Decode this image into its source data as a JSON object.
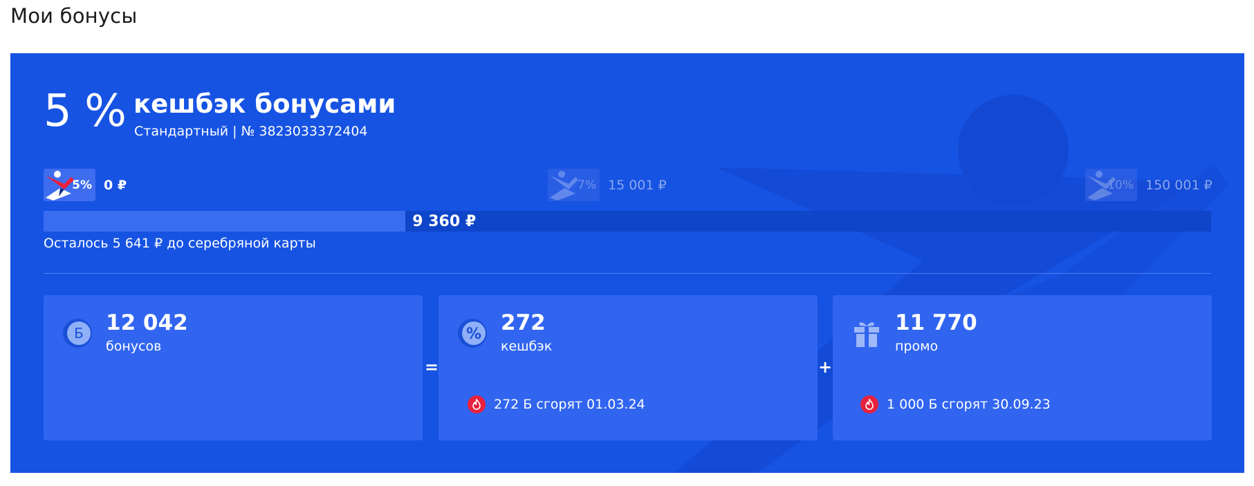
{
  "page": {
    "title": "Мои бонусы"
  },
  "header": {
    "cashback_rate": "5 %",
    "cashback_title": "кешбэк бонусами",
    "card_info": "Стандартный | № 3823033372404"
  },
  "levels": [
    {
      "percent": "5%",
      "amount": "0 ₽",
      "active": true
    },
    {
      "percent": "7%",
      "amount": "15 001 ₽",
      "active": false
    },
    {
      "percent": "10%",
      "amount": "150 001 ₽",
      "active": false
    }
  ],
  "progress": {
    "value_label": "9 360 ₽",
    "fraction": 0.31,
    "remaining_text": "Осталось 5 641 ₽ до серебряной карты"
  },
  "cards": {
    "total": {
      "icon": "bonus-coin-icon",
      "icon_letter": "Б",
      "value": "12 042",
      "label": "бонусов"
    },
    "cashback": {
      "icon": "percent-icon",
      "icon_symbol": "%",
      "value": "272",
      "label": "кешбэк",
      "expiry": "272 Б сгорят 01.03.24"
    },
    "promo": {
      "icon": "gift-icon",
      "value": "11 770",
      "label": "промо",
      "expiry": "1 000 Б сгорят 30.09.23"
    }
  },
  "operators": {
    "equals": "=",
    "plus": "+"
  },
  "colors": {
    "panel": "#1653e3",
    "card": "#3165f0",
    "progress_track": "#0f45c9",
    "progress_fill": "#3a6cf2",
    "fire": "#e8213d"
  }
}
